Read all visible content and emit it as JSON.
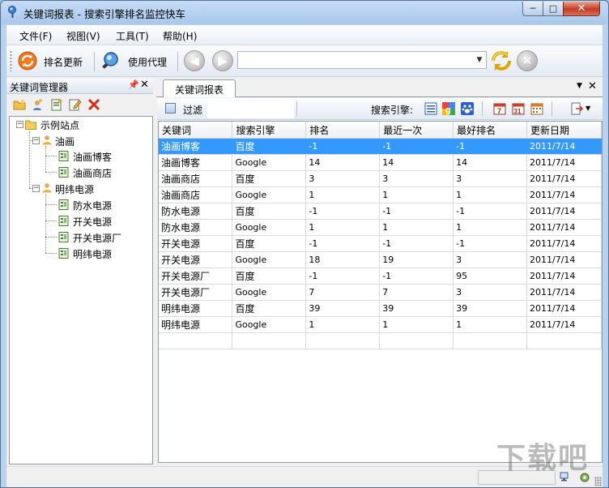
{
  "window": {
    "title": "关键词报表 - 搜索引擎排名监控快车",
    "min_label": "─",
    "max_label": "□",
    "close_label": "✕"
  },
  "menu": [
    "文件(F)",
    "视图(V)",
    "工具(T)",
    "帮助(H)"
  ],
  "toolbar": {
    "rank_update_label": "排名更新",
    "use_proxy_label": "使用代理",
    "back_icon": "back-arrow-icon",
    "forward_icon": "forward-arrow-icon",
    "address_value": "",
    "refresh_icon": "refresh-icon",
    "stop_icon": "stop-icon"
  },
  "left_panel": {
    "title": "关键词管理器",
    "pin_label": "ㅁ",
    "close_label": "✕",
    "tools": [
      "new-folder-icon",
      "add-user-icon",
      "add-keyword-icon",
      "edit-icon",
      "delete-icon"
    ],
    "tree": {
      "root": "示例站点",
      "groups": [
        {
          "label": "油画",
          "children": [
            "油画博客",
            "油画商店"
          ]
        },
        {
          "label": "明纬电源",
          "children": [
            "防水电源",
            "开关电源",
            "开关电源厂",
            "明纬电源"
          ]
        }
      ]
    }
  },
  "report": {
    "tab_label": "关键词报表",
    "tab_menu_label": "▼",
    "tab_close_label": "✕",
    "filter_label": "过滤",
    "filter_value": "",
    "engine_label": "搜索引擎:",
    "columns": [
      "关键词",
      "搜索引擎",
      "排名",
      "最近一次",
      "最好排名",
      "更新日期"
    ],
    "rows": [
      [
        "油画博客",
        "百度",
        "-1",
        "-1",
        "-1",
        "2011/7/14"
      ],
      [
        "油画博客",
        "Google",
        "14",
        "14",
        "14",
        "2011/7/14"
      ],
      [
        "油画商店",
        "百度",
        "3",
        "3",
        "3",
        "2011/7/14"
      ],
      [
        "油画商店",
        "Google",
        "1",
        "1",
        "1",
        "2011/7/14"
      ],
      [
        "防水电源",
        "百度",
        "-1",
        "-1",
        "-1",
        "2011/7/14"
      ],
      [
        "防水电源",
        "Google",
        "1",
        "1",
        "1",
        "2011/7/14"
      ],
      [
        "开关电源",
        "百度",
        "-1",
        "-1",
        "-1",
        "2011/7/14"
      ],
      [
        "开关电源",
        "Google",
        "18",
        "19",
        "3",
        "2011/7/14"
      ],
      [
        "开关电源厂",
        "百度",
        "-1",
        "-1",
        "95",
        "2011/7/14"
      ],
      [
        "开关电源厂",
        "Google",
        "7",
        "7",
        "3",
        "2011/7/14"
      ],
      [
        "明纬电源",
        "百度",
        "39",
        "39",
        "39",
        "2011/7/14"
      ],
      [
        "明纬电源",
        "Google",
        "1",
        "1",
        "1",
        "2011/7/14"
      ]
    ],
    "selected_row": 0
  },
  "watermark": "下载吧",
  "colors": {
    "selection": "#3399ff",
    "title_gradient": "#a9c8ec",
    "close_button": "#c9452c"
  }
}
